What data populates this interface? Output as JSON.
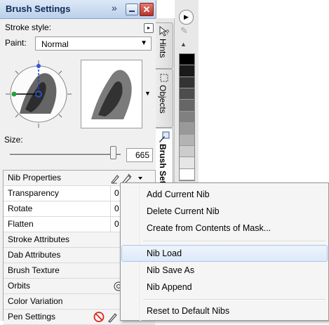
{
  "panel": {
    "title": "Brush Settings",
    "more_glyph": "»",
    "minimize_icon": "minimize-icon",
    "close_glyph": "✕",
    "stroke_style_label": "Stroke style:",
    "paint_label": "Paint:",
    "paint_value": "Normal",
    "size_label": "Size:",
    "size_value": "665",
    "size_fraction": 0.93
  },
  "properties": [
    {
      "label": "Nib Properties",
      "category": true,
      "icons": [
        "pen-icon",
        "brush-add-icon",
        "dropdown-icon"
      ]
    },
    {
      "label": "Transparency",
      "value": "0"
    },
    {
      "label": "Rotate",
      "value": "0"
    },
    {
      "label": "Flatten",
      "value": "0"
    },
    {
      "label": "Stroke Attributes",
      "category": true
    },
    {
      "label": "Dab Attributes",
      "category": true
    },
    {
      "label": "Brush Texture",
      "category": true
    },
    {
      "label": "Orbits",
      "category": true,
      "icons": [
        "orbits-icon"
      ]
    },
    {
      "label": "Color Variation",
      "category": true
    },
    {
      "label": "Pen Settings",
      "category": true,
      "icons": [
        "disabled-icon",
        "pen-icon"
      ]
    }
  ],
  "side_tabs": [
    "Hints",
    "Objects",
    "Brush Sett"
  ],
  "context_menu": {
    "items": [
      {
        "label": "Add Current Nib"
      },
      {
        "label": "Delete Current Nib"
      },
      {
        "label": "Create from Contents of Mask..."
      },
      {
        "separator": true
      },
      {
        "label": "Nib Load",
        "highlighted": true
      },
      {
        "label": "Nib Save As"
      },
      {
        "label": "Nib Append"
      },
      {
        "separator": true
      },
      {
        "label": "Reset to Default Nibs"
      }
    ]
  },
  "colors": {
    "titlebar": "#c9daef",
    "highlight": "#dde9f8",
    "swatches": [
      "#000000",
      "#1a1a1a",
      "#333333",
      "#4d4d4d",
      "#666666",
      "#808080",
      "#999999",
      "#b3b3b3",
      "#cccccc",
      "#e6e6e6",
      "#ffffff"
    ]
  }
}
